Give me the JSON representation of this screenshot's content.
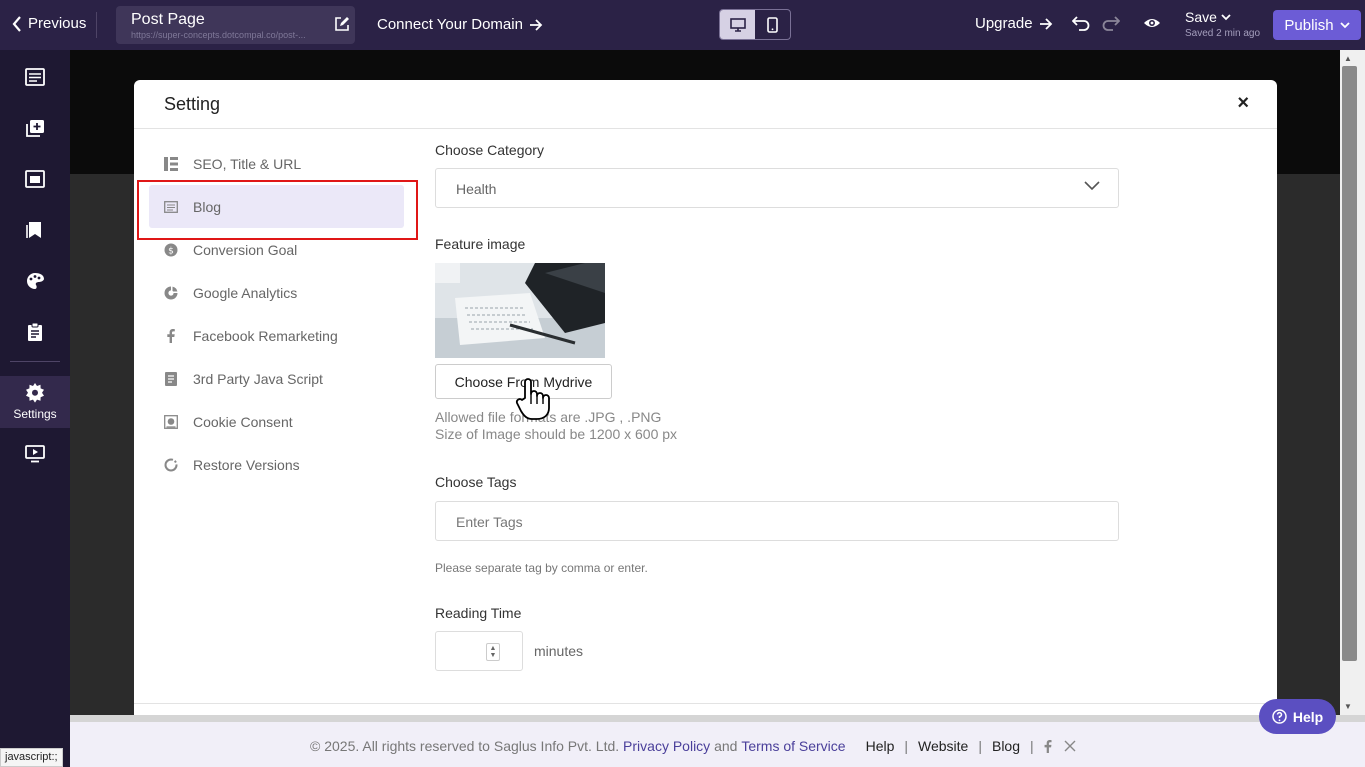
{
  "topbar": {
    "previous_label": "Previous",
    "page_title": "Post Page",
    "page_url": "https://super-concepts.dotcompal.co/post-...",
    "connect_domain": "Connect Your Domain",
    "upgrade": "Upgrade",
    "save": "Save",
    "saved_status": "Saved 2 min ago",
    "publish": "Publish"
  },
  "rail": {
    "settings_label": "Settings"
  },
  "modal": {
    "title": "Setting",
    "close": "×",
    "menu": [
      {
        "label": "SEO, Title & URL",
        "icon": "seo-icon"
      },
      {
        "label": "Blog",
        "icon": "blog-icon"
      },
      {
        "label": "Conversion Goal",
        "icon": "dollar-icon"
      },
      {
        "label": "Google Analytics",
        "icon": "analytics-icon"
      },
      {
        "label": "Facebook Remarketing",
        "icon": "facebook-icon"
      },
      {
        "label": "3rd Party Java Script",
        "icon": "script-icon"
      },
      {
        "label": "Cookie Consent",
        "icon": "cookie-icon"
      },
      {
        "label": "Restore Versions",
        "icon": "restore-icon"
      }
    ],
    "form": {
      "category_label": "Choose Category",
      "category_value": "Health",
      "feature_label": "Feature image",
      "choose_button": "Choose From Mydrive",
      "hint_formats": "Allowed file formats are .JPG , .PNG",
      "hint_size": "Size of Image should be 1200 x 600 px",
      "tags_label": "Choose Tags",
      "tags_placeholder": "Enter Tags",
      "tags_hint": "Please separate tag by comma or enter.",
      "reading_label": "Reading Time",
      "reading_unit": "minutes"
    }
  },
  "footer": {
    "copyright": "©  2025. All rights reserved to Saglus Info Pvt. Ltd.",
    "privacy": "Privacy Policy",
    "and": "and",
    "terms": "Terms of Service",
    "help": "Help",
    "website": "Website",
    "blog": "Blog"
  },
  "help_button": "Help",
  "status_bar": "javascript:;",
  "colors": {
    "topbar": "#2b2246",
    "accent": "#6c5cd6",
    "highlight_border": "#e01717",
    "active_menu_bg": "#ebe8f8"
  }
}
